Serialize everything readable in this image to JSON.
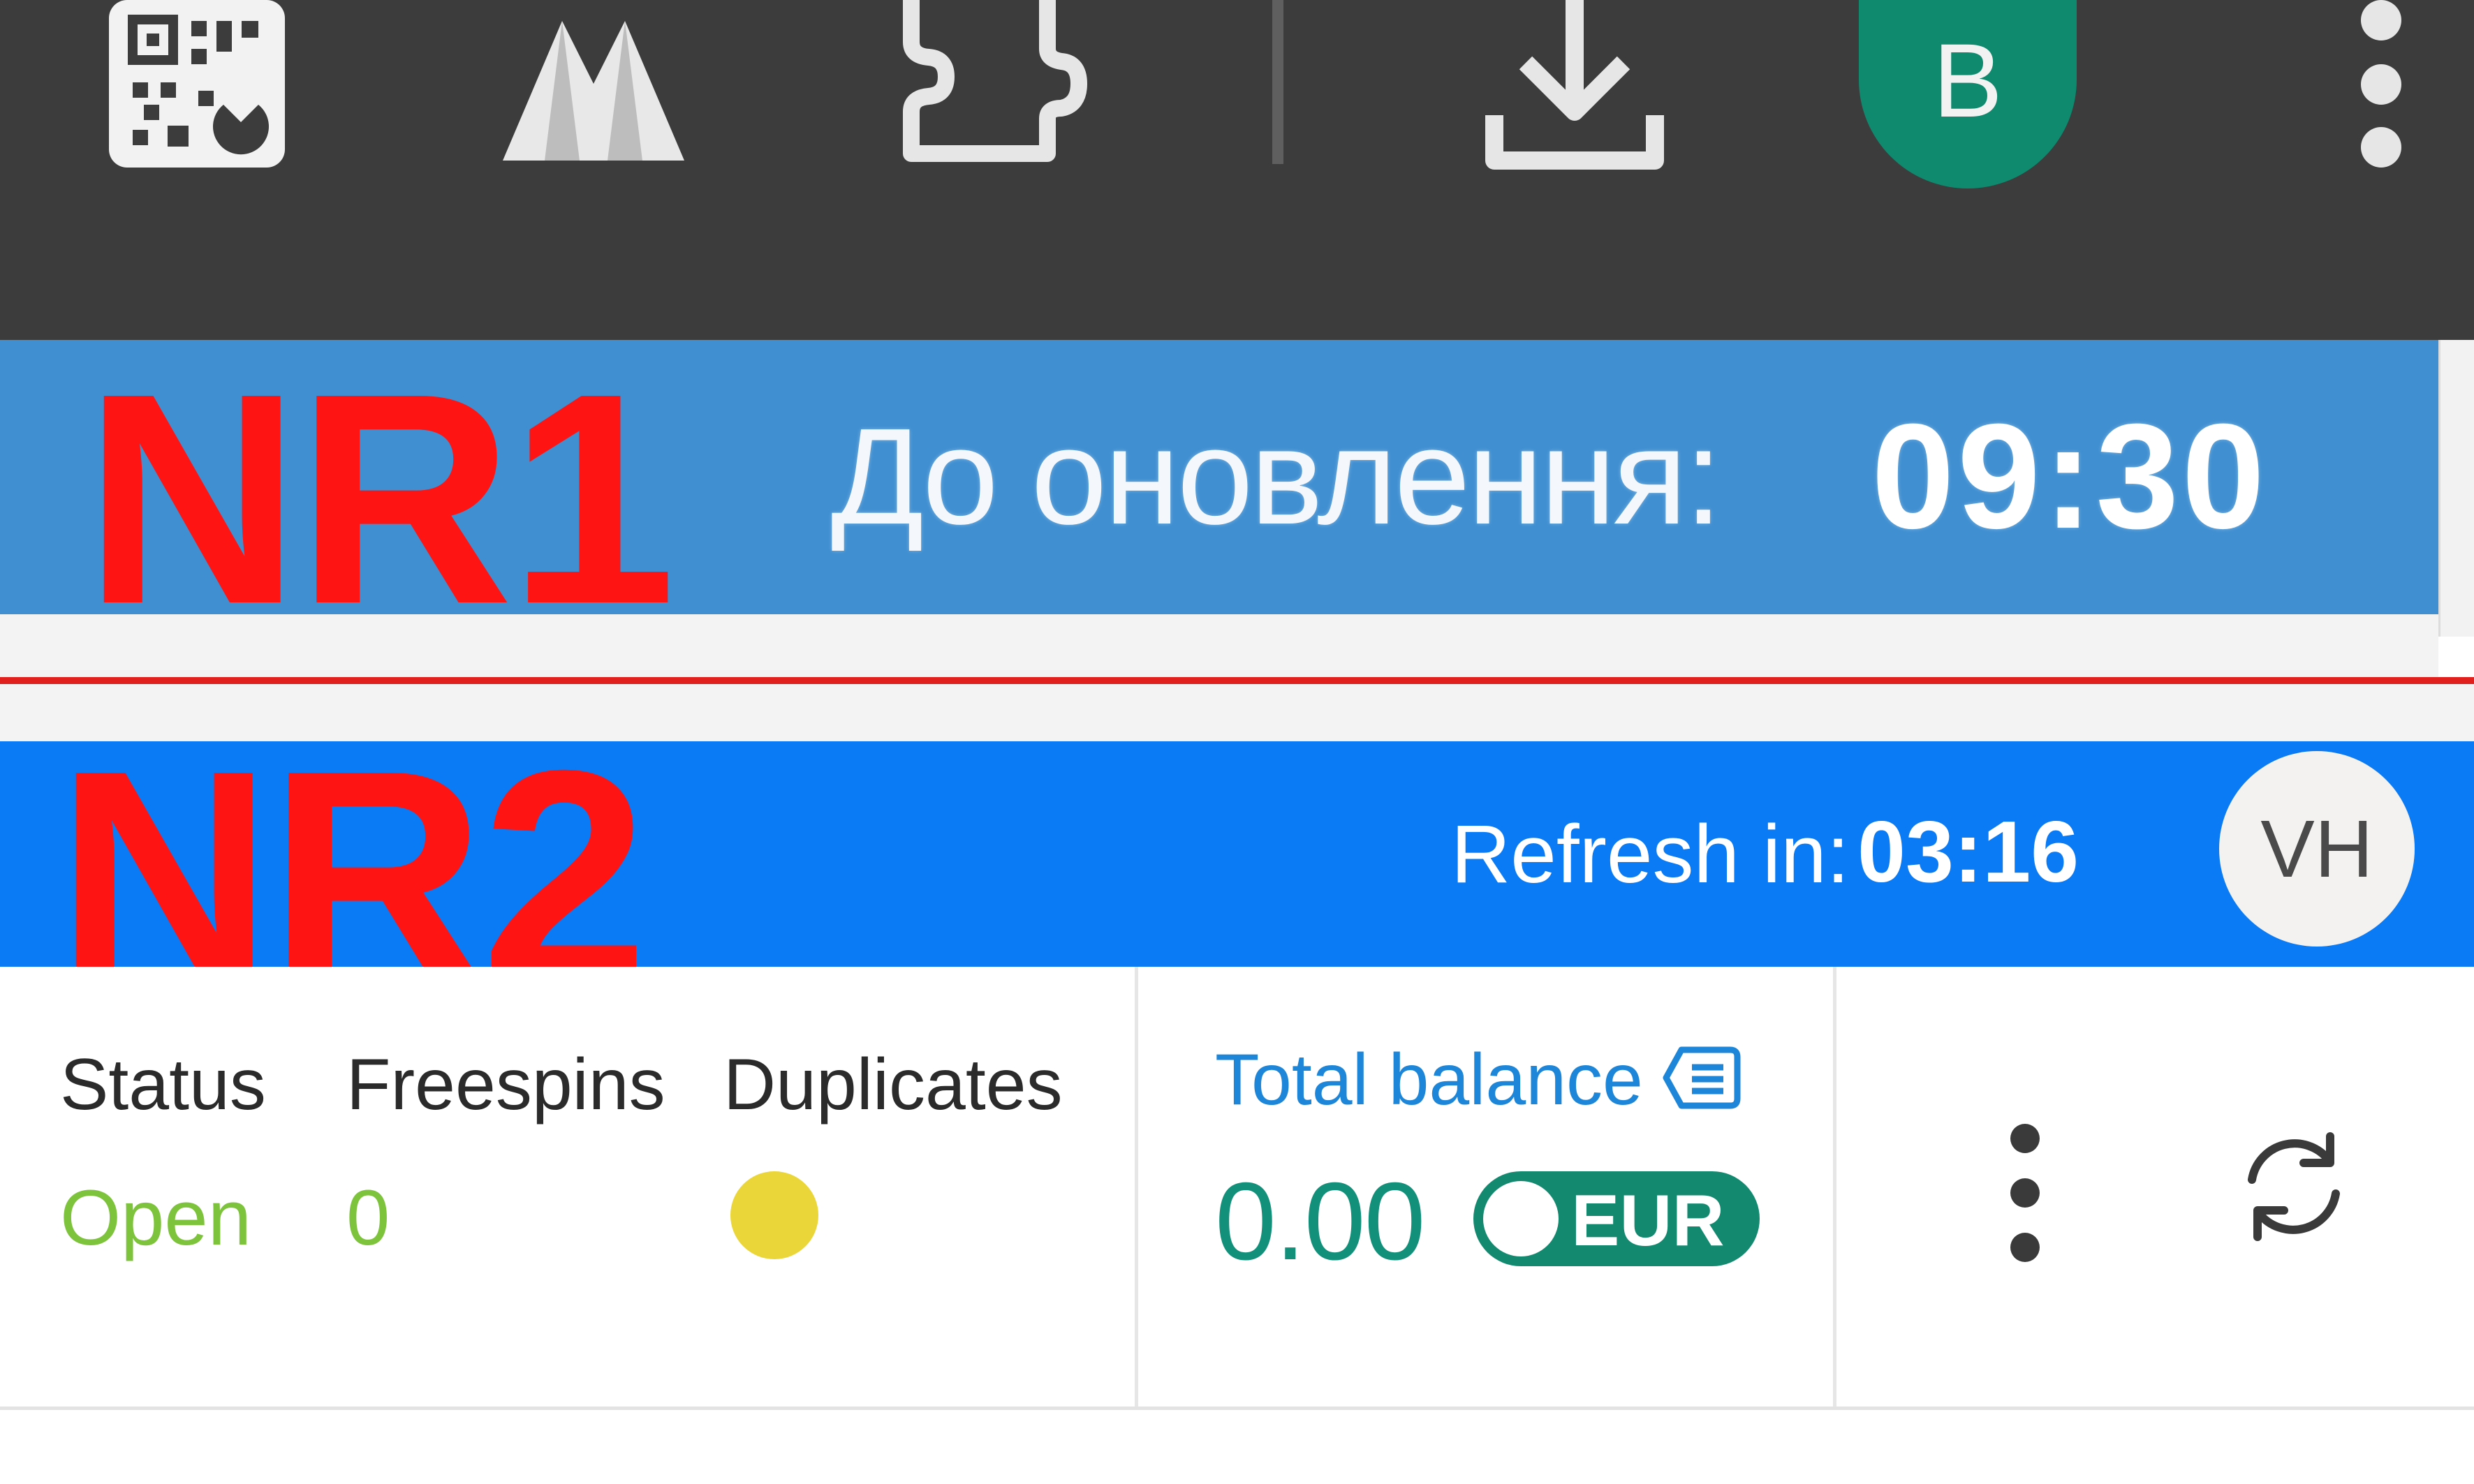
{
  "browser_toolbar": {
    "icons": [
      "qr-code-icon",
      "mountain-extension-icon",
      "puzzle-extensions-icon",
      "download-icon",
      "more-vert-icon"
    ],
    "profile_initial": "B",
    "colors": {
      "background": "#3c3c3c",
      "profile": "#0f8a6f"
    }
  },
  "annotations": {
    "nr1": "NR1",
    "nr2": "NR2",
    "color": "#ff1414"
  },
  "nr1": {
    "countdown_label": "До оновлення:",
    "countdown_time": "09:30",
    "color": "#3f8fd1"
  },
  "nr2": {
    "refresh_label": "Refresh in:",
    "refresh_time": "03:16",
    "avatar_initials": "VH",
    "color": "#0a7af5",
    "fields": {
      "status_label": "Status",
      "status_value": "Open",
      "freespins_label": "Freespins",
      "freespins_value": "0",
      "duplicates_label": "Duplicates",
      "duplicates_indicator_color": "#ebd63a"
    },
    "balance": {
      "label": "Total balance",
      "value": "0.00",
      "currency": "EUR",
      "icon": "list-icon"
    },
    "actions": [
      "more-vert-icon",
      "refresh-icon"
    ]
  }
}
